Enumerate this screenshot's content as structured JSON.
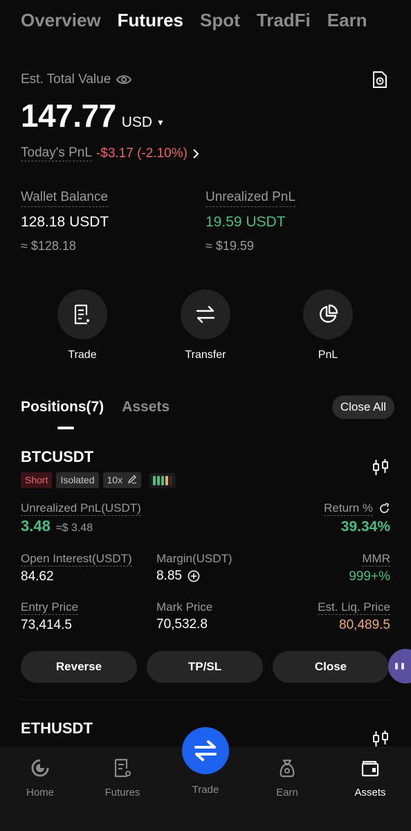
{
  "top_tabs": [
    "Overview",
    "Futures",
    "Spot",
    "TradFi",
    "Earn"
  ],
  "summary": {
    "est_label": "Est. Total Value",
    "total": "147.77",
    "currency": "USD",
    "pnl_label": "Today's PnL",
    "pnl_value": "-$3.17 (-2.10%)",
    "wallet_label": "Wallet Balance",
    "wallet_value": "128.18 USDT",
    "wallet_sub": "≈ $128.18",
    "unreal_label": "Unrealized PnL",
    "unreal_value": "19.59 USDT",
    "unreal_sub": "≈ $19.59"
  },
  "actions": [
    "Trade",
    "Transfer",
    "PnL"
  ],
  "section_tabs": [
    "Positions(7)",
    "Assets"
  ],
  "close_all": "Close All",
  "position": {
    "symbol": "BTCUSDT",
    "side": "Short",
    "margin_mode": "Isolated",
    "leverage": "10x",
    "unreal_label": "Unrealized PnL(USDT)",
    "unreal_value": "3.48",
    "unreal_usd": "≈$ 3.48",
    "return_label": "Return %",
    "return_value": "39.34%",
    "oi_label": "Open Interest(USDT)",
    "oi_value": "84.62",
    "margin_label": "Margin(USDT)",
    "margin_value": "8.85",
    "mmr_label": "MMR",
    "mmr_value": "999+%",
    "entry_label": "Entry Price",
    "entry_value": "73,414.5",
    "mark_label": "Mark Price",
    "mark_value": "70,532.8",
    "liq_label": "Est. Liq. Price",
    "liq_value": "80,489.5",
    "buttons": [
      "Reverse",
      "TP/SL",
      "Close"
    ]
  },
  "next_position": {
    "symbol": "ETHUSDT"
  },
  "bottom_nav": [
    "Home",
    "Futures",
    "Trade",
    "Earn",
    "Assets"
  ],
  "colors": {
    "red": "#f0626a",
    "green": "#4dbc7f",
    "orange": "#f0a87c",
    "accent": "#1e62f0"
  }
}
